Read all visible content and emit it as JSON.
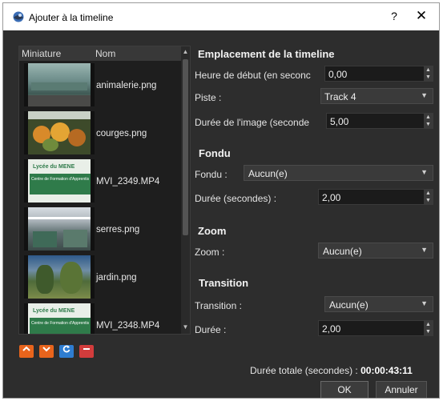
{
  "window": {
    "title": "Ajouter à la timeline",
    "help_label": "?",
    "close_label": "✕"
  },
  "list": {
    "headers": {
      "thumbnail": "Miniature",
      "name": "Nom"
    },
    "items": [
      {
        "name": "animalerie.png"
      },
      {
        "name": "courges.png"
      },
      {
        "name": "MVI_2349.MP4",
        "thumb_line1": "Lycée du MENE",
        "thumb_line2": "Centre de Formation d'Apprentis"
      },
      {
        "name": "serres.png"
      },
      {
        "name": "jardin.png"
      },
      {
        "name": "MVI_2348.MP4",
        "thumb_line1": "Lycée du MENE",
        "thumb_line2": "Centre de Formation d'Apprentis"
      }
    ]
  },
  "toolbar": {
    "up_icon": "chevron-up-icon",
    "down_icon": "chevron-down-icon",
    "shuffle_icon": "shuffle-icon",
    "remove_icon": "remove-icon"
  },
  "placement": {
    "title": "Emplacement de la timeline",
    "start_label": "Heure de début (en seconc",
    "start_value": "0,00",
    "track_label": "Piste :",
    "track_value": "Track 4",
    "image_duration_label": "Durée de l'image (seconde",
    "image_duration_value": "5,00"
  },
  "fade": {
    "title": "Fondu",
    "fade_label": "Fondu :",
    "fade_value": "Aucun(e)",
    "duration_label": "Durée (secondes) :",
    "duration_value": "2,00"
  },
  "zoom": {
    "title": "Zoom",
    "zoom_label": "Zoom :",
    "zoom_value": "Aucun(e)"
  },
  "transition": {
    "title": "Transition",
    "transition_label": "Transition :",
    "transition_value": "Aucun(e)",
    "duration_label": "Durée :",
    "duration_value": "2,00"
  },
  "footer": {
    "total_label": "Durée totale (secondes) :",
    "total_value": "00:00:43:11",
    "ok": "OK",
    "cancel": "Annuler"
  },
  "colors": {
    "accent_orange": "#e8641c",
    "accent_blue": "#2e7dd1",
    "accent_red": "#d23c3c"
  }
}
